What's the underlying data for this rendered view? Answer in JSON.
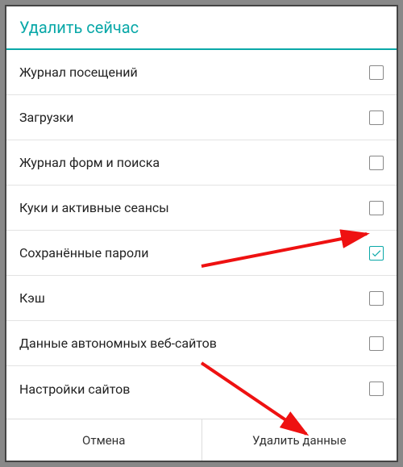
{
  "header": {
    "title": "Удалить сейчас"
  },
  "items": [
    {
      "label": "Журнал посещений",
      "checked": false
    },
    {
      "label": "Загрузки",
      "checked": false
    },
    {
      "label": "Журнал форм и поиска",
      "checked": false
    },
    {
      "label": "Куки и активные сеансы",
      "checked": false
    },
    {
      "label": "Сохранённые пароли",
      "checked": true
    },
    {
      "label": "Кэш",
      "checked": false
    },
    {
      "label": "Данные автономных веб-сайтов",
      "checked": false
    },
    {
      "label": "Настройки сайтов",
      "checked": false
    }
  ],
  "footer": {
    "cancel": "Отмена",
    "confirm": "Удалить данные"
  }
}
